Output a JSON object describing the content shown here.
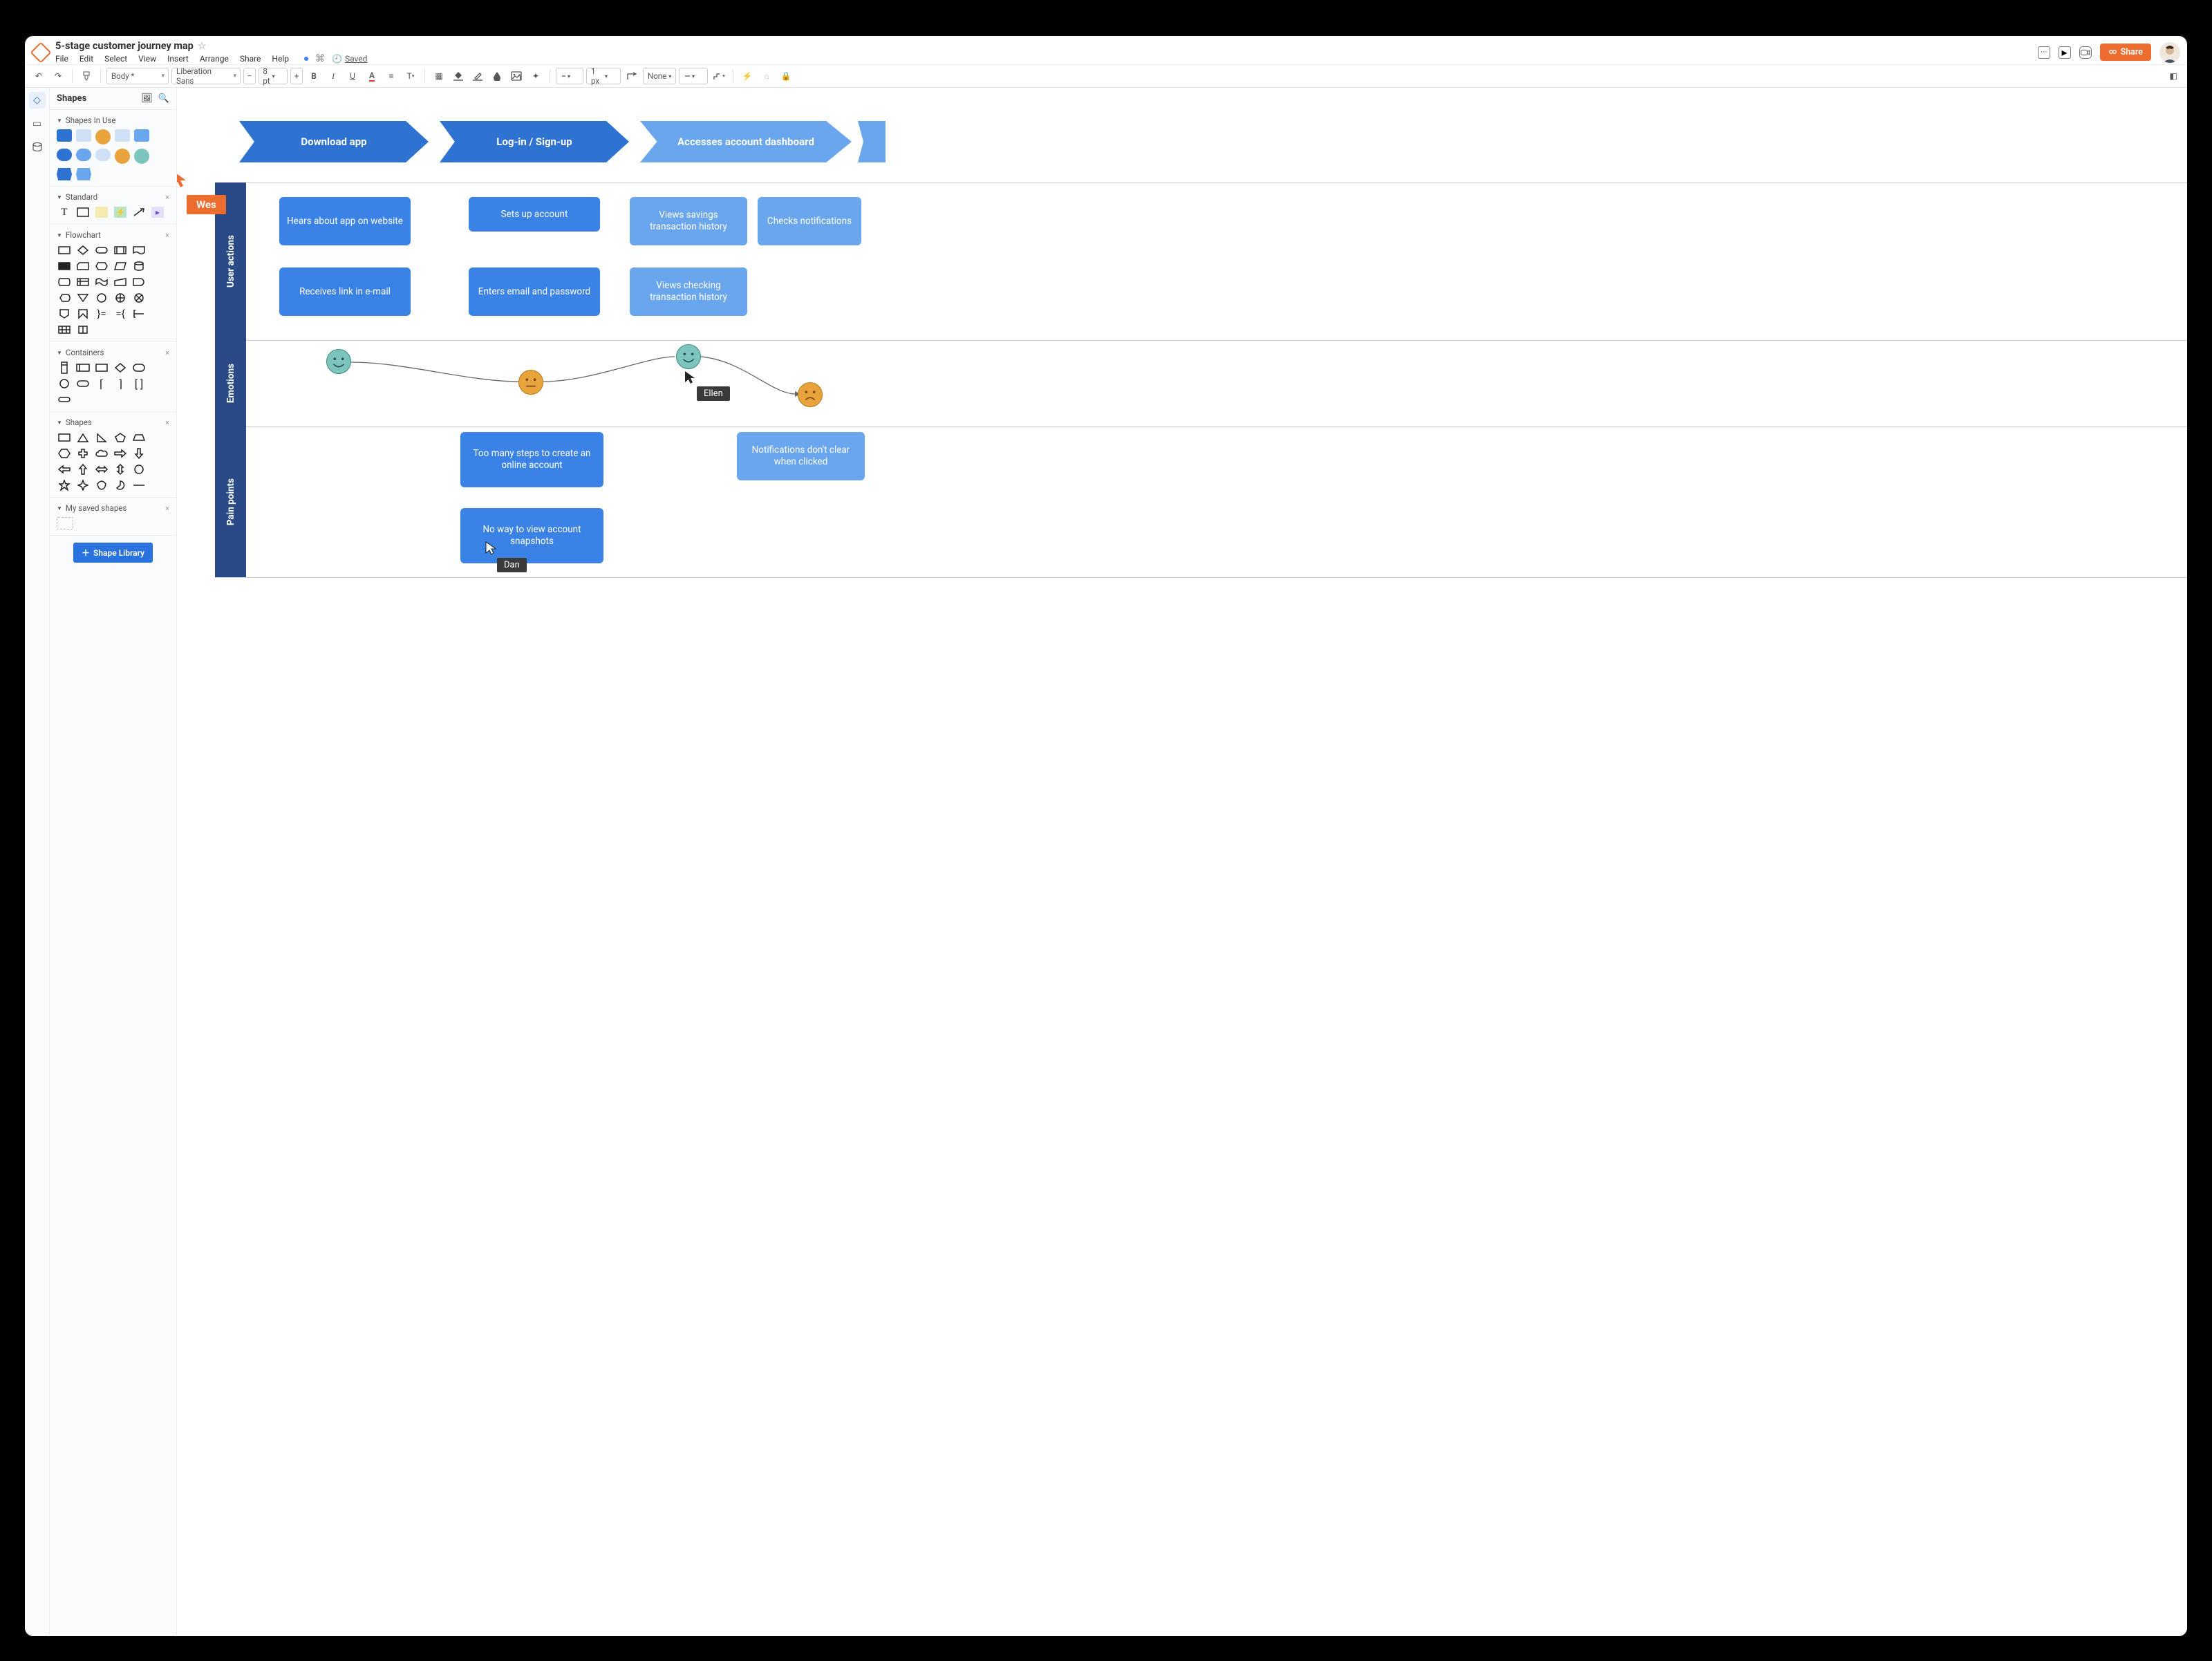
{
  "header": {
    "doc_title": "5-stage customer journey map",
    "menu": [
      "File",
      "Edit",
      "Select",
      "View",
      "Insert",
      "Arrange",
      "Share",
      "Help"
    ],
    "saved_label": "Saved",
    "share_label": "Share"
  },
  "toolbar": {
    "style_select": "Body *",
    "font_select": "Liberation Sans",
    "size_value": "8 pt",
    "line_width": "1 px",
    "line_style": "None",
    "bold": "B",
    "italic": "I",
    "underline": "U"
  },
  "sidebar": {
    "title": "Shapes",
    "sections": {
      "in_use": "Shapes In Use",
      "standard": "Standard",
      "flowchart": "Flowchart",
      "containers": "Containers",
      "shapes": "Shapes",
      "saved": "My saved shapes"
    },
    "library_btn": "Shape Library"
  },
  "canvas": {
    "stages": [
      {
        "label": "Download app",
        "fill": "#2e72d2"
      },
      {
        "label": "Log-in / Sign-up",
        "fill": "#2e72d2"
      },
      {
        "label": "Accesses account dashboard",
        "fill": "#6aa6ee"
      }
    ],
    "tracks": [
      {
        "key": "user_actions",
        "label": "User actions"
      },
      {
        "key": "emotions",
        "label": "Emotions"
      },
      {
        "key": "pain_points",
        "label": "Pain points"
      }
    ],
    "cards": {
      "ua_hears": "Hears about app on website",
      "ua_link": "Receives link in e-mail",
      "ua_setup": "Sets up account",
      "ua_enters": "Enters email and password",
      "ua_savings": "Views savings transaction history",
      "ua_checking": "Views checking transaction history",
      "ua_notif": "Checks notifications",
      "pp_steps": "Too many steps to create an online account",
      "pp_snapshot": "No way to view account snapshots",
      "pp_notif": "Notifications don't clear when clicked"
    },
    "cursors": {
      "wes": "Wes",
      "ellen": "Ellen",
      "dan": "Dan"
    }
  },
  "colors": {
    "blue": "#2e72d2",
    "blue_light": "#6aa6ee",
    "blue_pale": "#cfe0f7",
    "orange": "#ed6c30",
    "teal": "#7dc4bd",
    "amber": "#e8a33d",
    "track_header": "#2a4a87"
  }
}
